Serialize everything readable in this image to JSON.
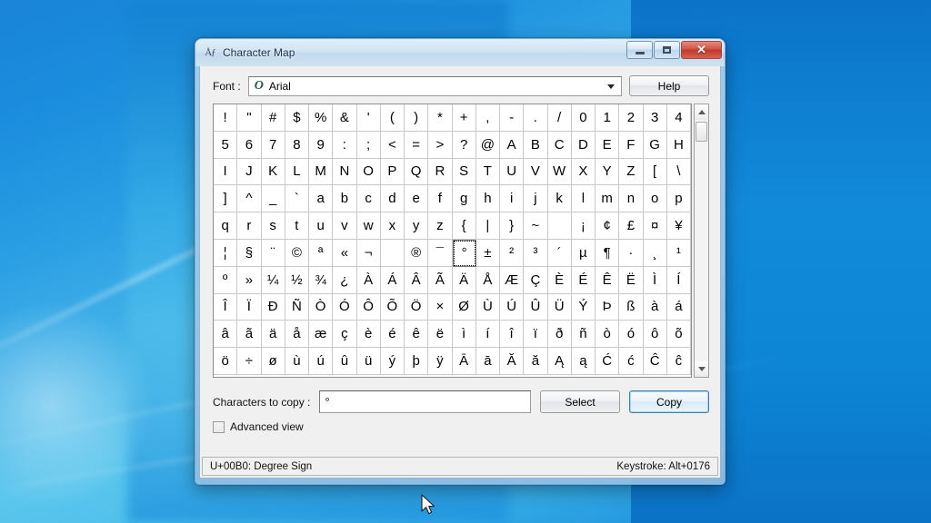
{
  "desktop": {
    "wallpaper_name": "windows-7-blue-wallpaper",
    "colors": {
      "top_blue": "#1a84d8",
      "mid_cyan": "#5cc6ed",
      "right_blue": "#0b74c9"
    },
    "cursor": "arrow-pointer"
  },
  "window": {
    "title": "Character Map",
    "icon": "character-map-icon",
    "controls": {
      "minimize_label": "–",
      "maximize_label": "☐",
      "close_label": "✕"
    }
  },
  "font_row": {
    "label": "Font :",
    "selected_font": "Arial",
    "font_type_icon": "O",
    "dropdown_icon": "chevron-down-icon",
    "help_label": "Help"
  },
  "grid": {
    "columns": 20,
    "selected_char": "°",
    "rows": [
      [
        "!",
        "\"",
        "#",
        "$",
        "%",
        "&",
        "'",
        "(",
        ")",
        "*",
        "+",
        ",",
        "-",
        ".",
        "/",
        "0",
        "1",
        "2",
        "3",
        "4"
      ],
      [
        "5",
        "6",
        "7",
        "8",
        "9",
        ":",
        ";",
        "<",
        "=",
        ">",
        "?",
        "@",
        "A",
        "B",
        "C",
        "D",
        "E",
        "F",
        "G",
        "H"
      ],
      [
        "I",
        "J",
        "K",
        "L",
        "M",
        "N",
        "O",
        "P",
        "Q",
        "R",
        "S",
        "T",
        "U",
        "V",
        "W",
        "X",
        "Y",
        "Z",
        "[",
        "\\"
      ],
      [
        "]",
        "^",
        "_",
        "`",
        "a",
        "b",
        "c",
        "d",
        "e",
        "f",
        "g",
        "h",
        "i",
        "j",
        "k",
        "l",
        "m",
        "n",
        "o",
        "p"
      ],
      [
        "q",
        "r",
        "s",
        "t",
        "u",
        "v",
        "w",
        "x",
        "y",
        "z",
        "{",
        "|",
        "}",
        "~",
        " ",
        "¡",
        "¢",
        "£",
        "¤",
        "¥"
      ],
      [
        "¦",
        "§",
        "¨",
        "©",
        "ª",
        "«",
        "¬",
        "­",
        "®",
        "¯",
        "°",
        "±",
        "²",
        "³",
        "´",
        "µ",
        "¶",
        "·",
        "¸",
        "¹"
      ],
      [
        "º",
        "»",
        "¼",
        "½",
        "¾",
        "¿",
        "À",
        "Á",
        "Â",
        "Ã",
        "Ä",
        "Å",
        "Æ",
        "Ç",
        "È",
        "É",
        "Ê",
        "Ë",
        "Ì",
        "Í"
      ],
      [
        "Î",
        "Ï",
        "Ð",
        "Ñ",
        "Ò",
        "Ó",
        "Ô",
        "Õ",
        "Ö",
        "×",
        "Ø",
        "Ù",
        "Ú",
        "Û",
        "Ü",
        "Ý",
        "Þ",
        "ß",
        "à",
        "á"
      ],
      [
        "â",
        "ã",
        "ä",
        "å",
        "æ",
        "ç",
        "è",
        "é",
        "ê",
        "ë",
        "ì",
        "í",
        "î",
        "ï",
        "ð",
        "ñ",
        "ò",
        "ó",
        "ô",
        "õ"
      ],
      [
        "ö",
        "÷",
        "ø",
        "ù",
        "ú",
        "û",
        "ü",
        "ý",
        "þ",
        "ÿ",
        "Ā",
        "ā",
        "Ă",
        "ă",
        "Ą",
        "ą",
        "Ć",
        "ć",
        "Ĉ",
        "ĉ"
      ]
    ],
    "scrollbar": {
      "up_icon": "scroll-up-arrow-icon",
      "down_icon": "scroll-down-arrow-icon",
      "thumb": "scroll-thumb"
    }
  },
  "copy_row": {
    "label": "Characters to copy :",
    "input_value": "°",
    "input_placeholder": "",
    "select_label": "Select",
    "copy_label": "Copy"
  },
  "advanced": {
    "label": "Advanced view",
    "checked": false
  },
  "statusbar": {
    "left": "U+00B0: Degree Sign",
    "right": "Keystroke: Alt+0176"
  }
}
